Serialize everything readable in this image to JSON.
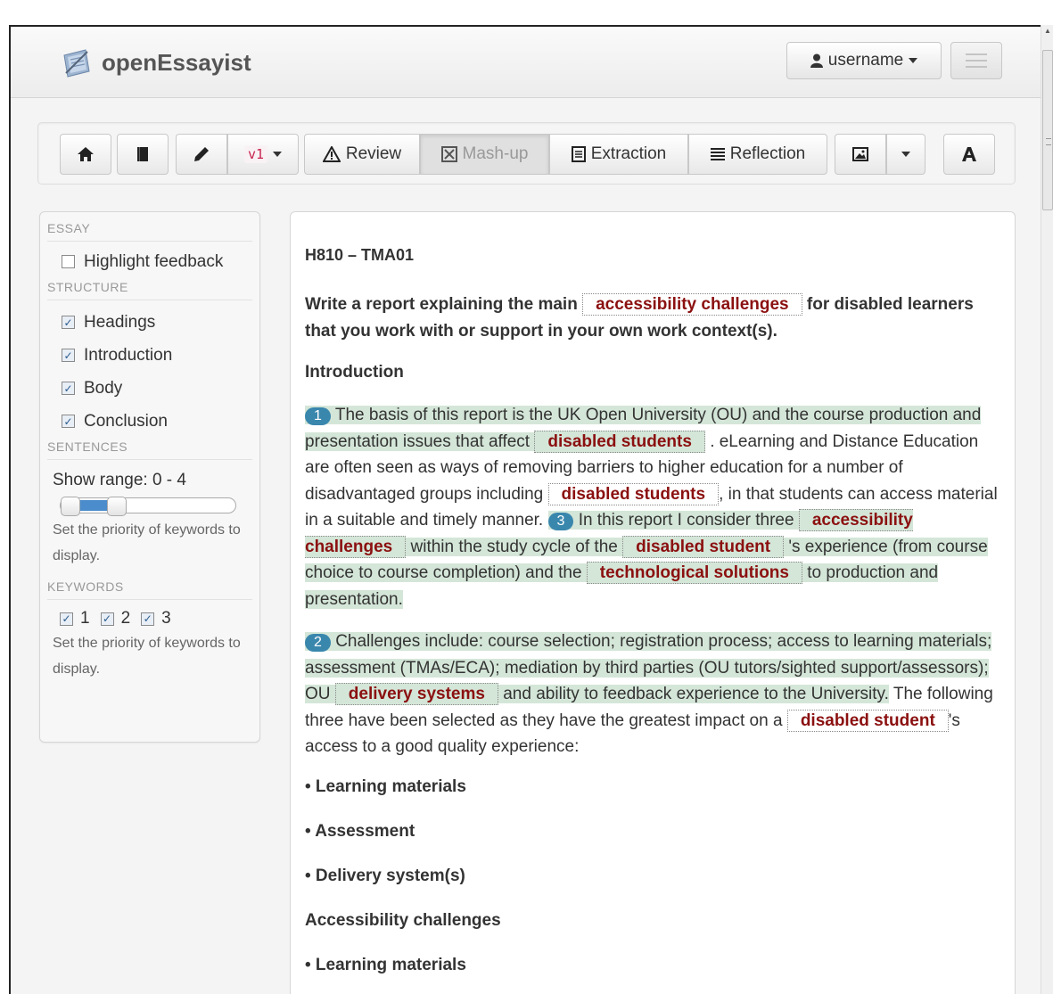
{
  "app": {
    "name": "openEssayist"
  },
  "user": {
    "label": "username"
  },
  "toolbar": {
    "version": "v1",
    "review": "Review",
    "mashup": "Mash-up",
    "extraction": "Extraction",
    "reflection": "Reflection"
  },
  "sidebar": {
    "essay_header": "ESSAY",
    "highlight_feedback": "Highlight feedback",
    "structure_header": "STRUCTURE",
    "structure_items": [
      "Headings",
      "Introduction",
      "Body",
      "Conclusion"
    ],
    "sentences_header": "SENTENCES",
    "show_range": "Show range: 0 - 4",
    "sentences_hint": "Set the priority of keywords to display.",
    "keywords_header": "KEYWORDS",
    "keyword_levels": [
      "1",
      "2",
      "3"
    ],
    "keywords_hint": "Set the priority of keywords to display."
  },
  "essay": {
    "title": "H810 – TMA01",
    "prompt_a": "Write a report explaining the main",
    "prompt_kw": "accessibility challenges",
    "prompt_b": "for disabled learners that you work with or support in your own work context(s).",
    "intro_heading": "Introduction",
    "p1": {
      "n1": "1",
      "s1": "The basis of this report is the UK Open University (OU) and the course production and presentation issues that affect",
      "kw1": "disabled students",
      "t1": ". eLearning and Distance Education are often seen as ways of removing barriers to higher education for a number of disadvantaged groups including",
      "kw2": "disabled students",
      "t2": ", in that students can access material in a suitable and timely manner.",
      "n3": "3",
      "s3a": "In this report I consider three",
      "kw3": "accessibility challenges",
      "s3b": "within the study cycle of the",
      "kw4": "disabled student",
      "s3c": "'s experience (from course choice to course completion) and the",
      "kw5": "technological solutions",
      "s3d": "to production and presentation."
    },
    "p2": {
      "n2": "2",
      "s2a": "Challenges include: course selection; registration process; access to learning materials; assessment (TMAs/ECA); mediation by third parties (OU tutors/sighted support/assessors); OU",
      "kw1": "delivery systems",
      "s2b": "and ability to feedback experience to the University.",
      "t1": "The following three have been selected as they have the greatest impact on a",
      "kw2": "disabled student",
      "t2": "'s access to a good quality experience:"
    },
    "bullets": [
      "• Learning materials",
      "• Assessment",
      "• Delivery system(s)"
    ],
    "ac_heading": "Accessibility challenges",
    "ac_bullet": "• Learning materials"
  }
}
